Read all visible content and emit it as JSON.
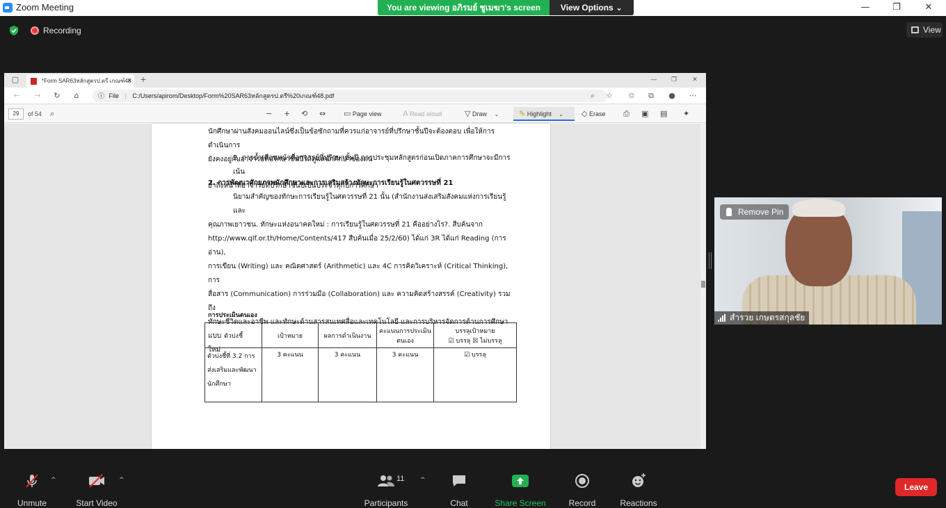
{
  "window": {
    "title": "Zoom Meeting",
    "controls": {
      "minimize": "—",
      "maximize": "❐",
      "close": "✕"
    }
  },
  "share_banner": {
    "text": "You are viewing อภิรมย์ ชูเมฆา's screen"
  },
  "view_options": {
    "label": "View Options ⌄"
  },
  "meeting_top": {
    "recording_label": "Recording",
    "view_label": "View"
  },
  "browser": {
    "tab_title": "*Form SAR63หลักสูตรป.ตรี เกณฑ์48",
    "tab_close": "✕",
    "new_tab": "+",
    "url_scheme": "File",
    "url": "C:/Users/apirom/Desktop/Form%20SAR63หลักสูตรป.ตรี%20เกณฑ์48.pdf",
    "win_controls": {
      "minimize": "—",
      "maximize": "❐",
      "close": "✕"
    }
  },
  "pdf_toolbar": {
    "page_number": "29",
    "page_total": "of 54",
    "page_view": "Page view",
    "read_aloud": "Read aloud",
    "draw": "Draw",
    "highlight": "Highlight",
    "erase": "Erase"
  },
  "document": {
    "lines_top": [
      "นักศึกษาผ่านสังคมออนไลน์ซึ่งเป็นข้อซักถามที่ควรแก่อาจารย์ที่ปรึกษาชั้นปีจะต้องตอบ เพื่อให้การดำเนินการ",
      "ยังคงอยู่กับอาจารย์ที่ปรึกษาชั้นปีได้ดูแลนักศึกษาของตน"
    ],
    "item2": [
      "2. การย้ำเตือนหน้าที่อาจารย์ที่ปรึกษาชั้นปี การประชุมหลักสูตรก่อนเปิดภาคการศึกษาจะมีการเน้น",
      "ย้ำถึงหน้าที่อาจารย์ที่ปรึกษาชั้นปีเป็นประจำทุกปีการศึกษา"
    ],
    "heading": "2. การพัฒนาศักยภาพนักศึกษาและการเสริมสร้างทักษะการเรียนรู้ในศตวรรษที่ 21",
    "body": [
      "นิยามสำคัญของทักษะการเรียนรู้ในศตวรรษที่ 21 นั้น (สำนักงานส่งเสริมสังคมแห่งการเรียนรู้และ",
      "คุณภาพเยาวชน. ทักษะแห่งอนาคตใหม่ : การเรียนรู้ในศตวรรษที่ 21 คืออย่างไร?. สืบค้นจาก",
      "http://www.qlf.or.th/Home/Contents/417 สืบค้นเมื่อ 25/2/60) ได้แก่ 3R ได้แก่ Reading (การอ่าน),",
      "การเขียน (Writing) และ คณิตศาสตร์ (Arithmetic) และ 4C การคิดวิเคราะห์ (Critical Thinking), การ",
      "สื่อสาร (Communication) การร่วมมือ (Collaboration) และ ความคิดสร้างสรรค์ (Creativity) รวมถึง",
      "ทักษะชีวิตและอาชีพ และทักษะด้านสารสนเทศสื่อและเทคโนโลยี และการบริหารจัดการด้านการศึกษาแบบ",
      "ใหม่"
    ],
    "self_eval_title": "การประเมินตนเอง",
    "table": {
      "headers": [
        "ตัวบ่งชี้",
        "เป้าหมาย",
        "ผลการดำเนินงาน",
        "คะแนนการประเมินตนเอง",
        "บรรลุเป้าหมาย"
      ],
      "header_sub": "☑ บรรลุ ☒ ไม่บรรลุ",
      "row": [
        "ตัวบ่งชี้ที่ 3.2 การส่งเสริมและพัฒนานักศึกษา",
        "3 คะแนน",
        "3 คะแนน",
        "3 คะแนน",
        "☑ บรรลุ"
      ]
    }
  },
  "participant": {
    "remove_pin": "Remove Pin",
    "name": "สำรวย เกษตรสกุลชัย"
  },
  "bottom_bar": {
    "unmute": "Unmute",
    "start_video": "Start Video",
    "participants": "Participants",
    "participants_count": "11",
    "chat": "Chat",
    "share_screen": "Share Screen",
    "record": "Record",
    "reactions": "Reactions",
    "leave": "Leave"
  }
}
